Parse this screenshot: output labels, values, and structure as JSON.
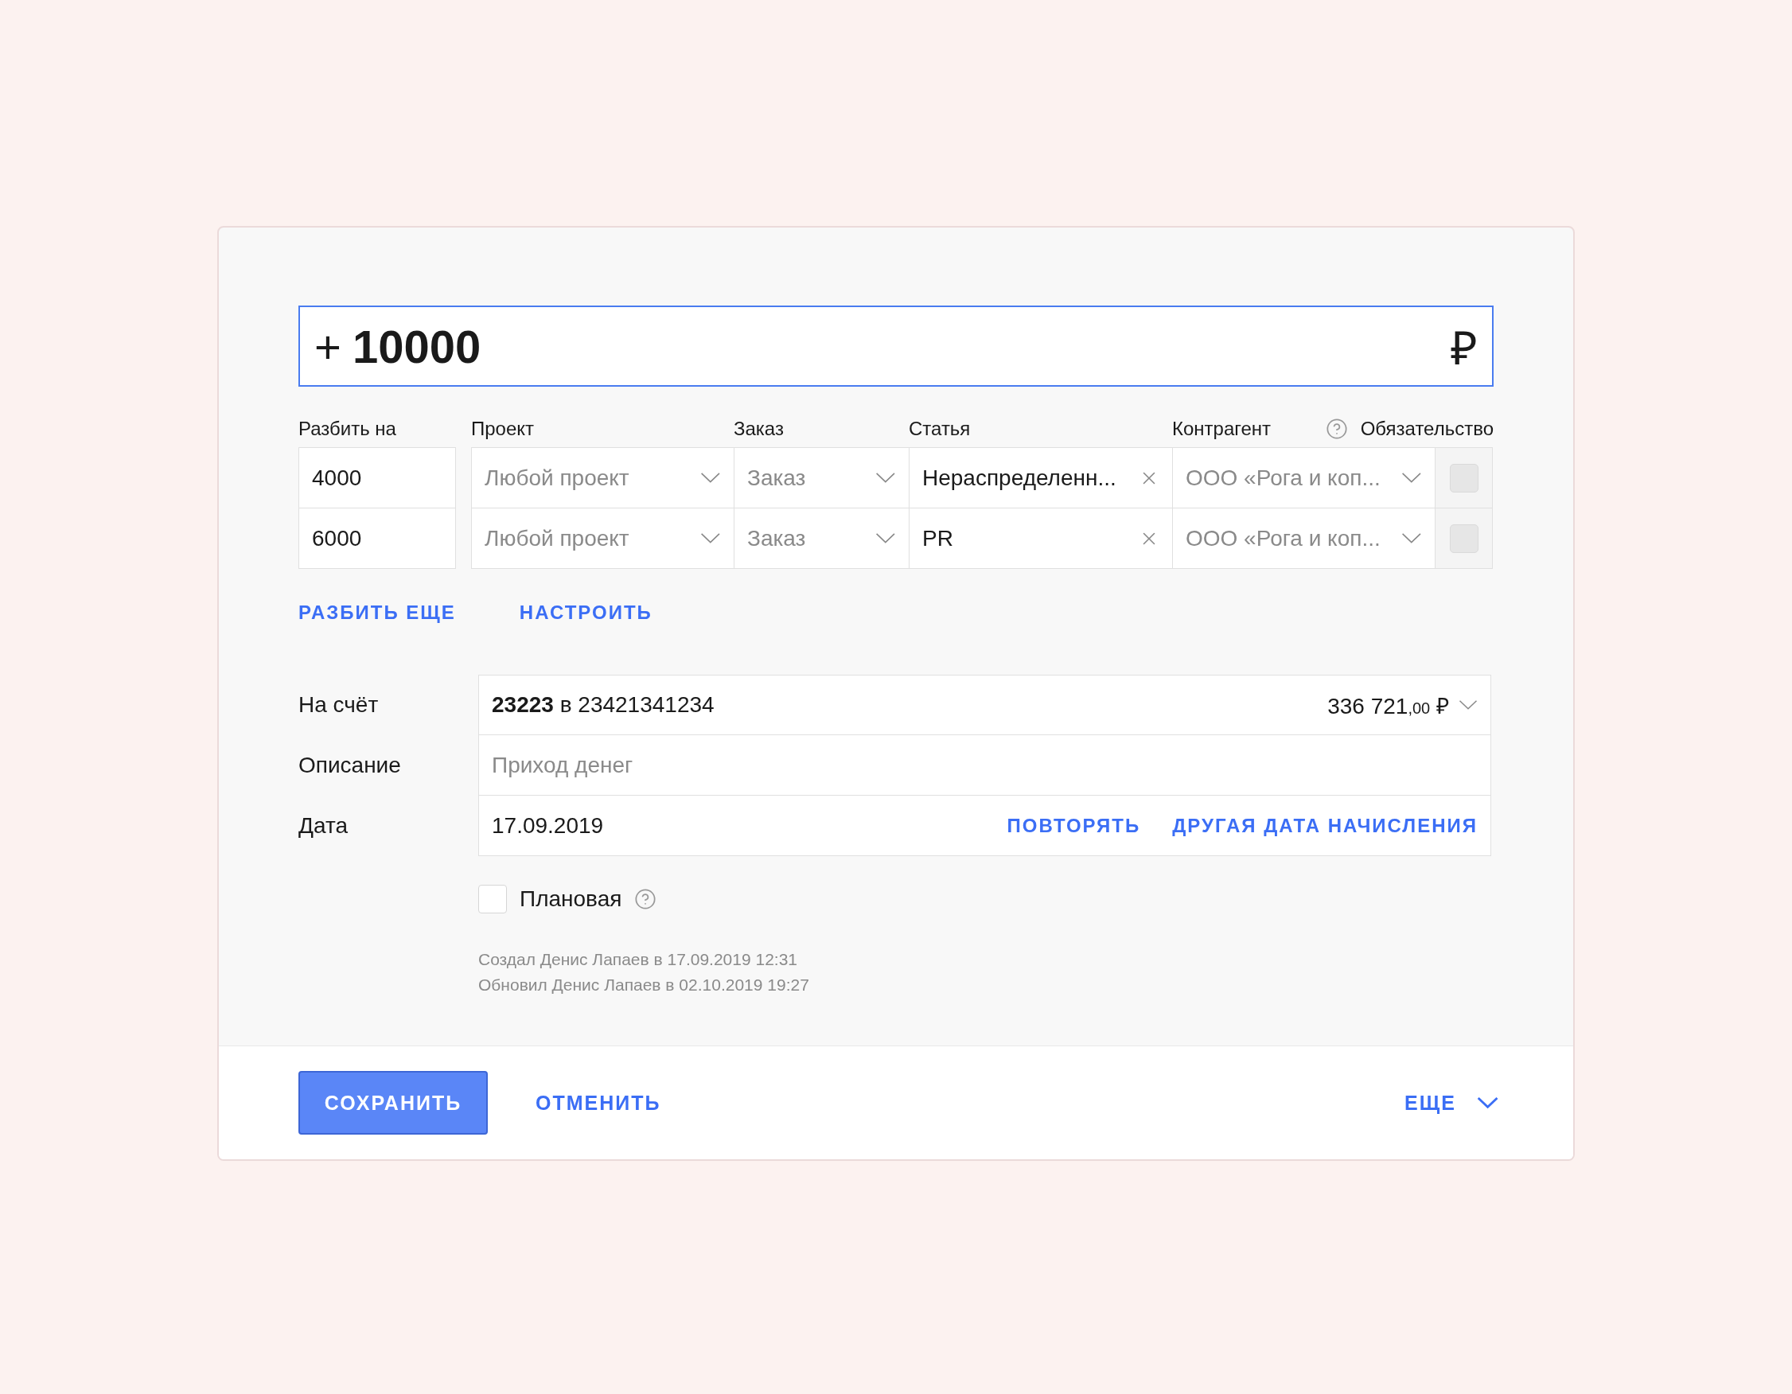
{
  "amount": {
    "sign": "+",
    "value": "10000",
    "currency": "₽"
  },
  "split": {
    "columns": [
      {
        "kind": "amount",
        "label": "Разбить на"
      },
      {
        "kind": "project",
        "label": "Проект"
      },
      {
        "kind": "order",
        "label": "Заказ"
      },
      {
        "kind": "article",
        "label": "Статья"
      },
      {
        "kind": "counterparty",
        "label": "Контрагент",
        "help": true
      },
      {
        "kind": "obligation",
        "label": "Обязательство"
      }
    ],
    "rows": [
      {
        "amount": "4000",
        "project": "Любой проект",
        "order": "Заказ",
        "article": "Нераспределенн...",
        "counterparty": "ООО «Рога и коп...",
        "obligation": false
      },
      {
        "amount": "6000",
        "project": "Любой проект",
        "order": "Заказ",
        "article": "PR",
        "counterparty": "ООО «Рога и коп...",
        "obligation": false
      }
    ]
  },
  "split_links": [
    "РАЗБИТЬ ЕЩЕ",
    "НАСТРОИТЬ"
  ],
  "account": {
    "label": "На счёт",
    "value": "**23223** в 23421341234",
    "balance": "336 721",
    "balance_cents": ",00",
    "currency": "₽"
  },
  "description": {
    "label": "Описание",
    "placeholder": "Приход денег"
  },
  "date": {
    "label": "Дата",
    "value": "17.09.2019",
    "actions": [
      "ПОВТОРЯТЬ",
      "ДРУГАЯ ДАТА НАЧИСЛЕНИЯ"
    ]
  },
  "planned": {
    "label": "Плановая",
    "checked": false
  },
  "meta": [
    "Создал Денис Лапаев в 17.09.2019 12:31",
    "Обновил Денис Лапаев в 02.10.2019 19:27"
  ],
  "footer": {
    "save": "СОХРАНИТЬ",
    "cancel": "ОТМЕНИТЬ",
    "more": "ЕЩЕ"
  }
}
